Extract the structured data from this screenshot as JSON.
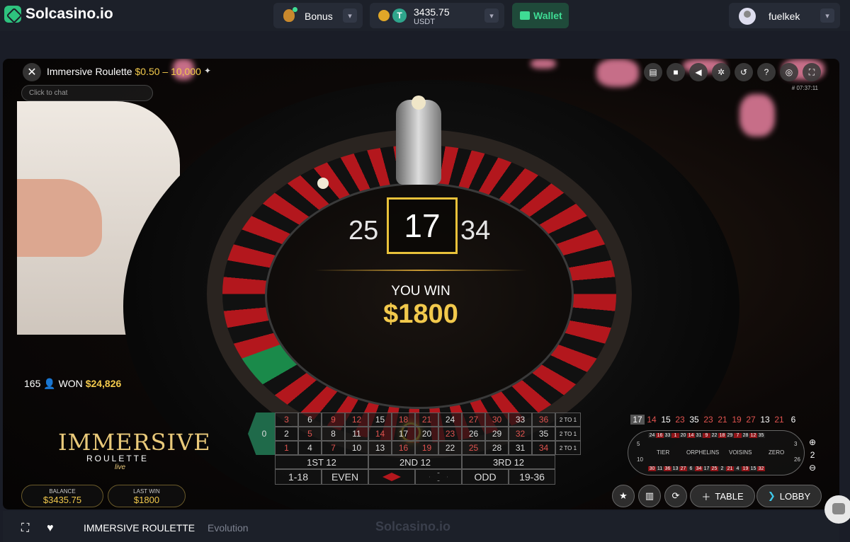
{
  "nav": {
    "brand": "Solcasino.io",
    "bonus_label": "Bonus",
    "balance": "3435.75",
    "currency": "USDT",
    "currency_symbol": "T",
    "wallet_label": "Wallet",
    "username": "fuelkek"
  },
  "game": {
    "title": "Immersive Roulette",
    "limits": "$0.50 – 10,000",
    "chat_placeholder": "Click to chat",
    "timestamp": "# 07:37:11",
    "result_prev": "25",
    "result": "17",
    "result_next": "34",
    "win_label": "YOU WIN",
    "win_amount": "$1800",
    "players": "165",
    "won_label": "WON",
    "won_amount": "$24,826",
    "brand_name": "IMMERSIVE",
    "brand_sub": "ROULETTE",
    "brand_live": "live",
    "balance_label": "BALANCE",
    "balance_value": "$3435.75",
    "lastwin_label": "LAST WIN",
    "lastwin_value": "$1800",
    "table_label": "TABLE",
    "lobby_label": "LOBBY"
  },
  "bet_grid": {
    "zero": "0",
    "rows": [
      [
        "3",
        "6",
        "9",
        "12",
        "15",
        "18",
        "21",
        "24",
        "27",
        "30",
        "33",
        "36"
      ],
      [
        "2",
        "5",
        "8",
        "11",
        "14",
        "17",
        "20",
        "23",
        "26",
        "29",
        "32",
        "35"
      ],
      [
        "1",
        "4",
        "7",
        "10",
        "13",
        "16",
        "19",
        "22",
        "25",
        "28",
        "31",
        "34"
      ]
    ],
    "red_numbers": [
      "1",
      "3",
      "5",
      "7",
      "9",
      "12",
      "14",
      "16",
      "18",
      "19",
      "21",
      "23",
      "25",
      "27",
      "30",
      "32",
      "34",
      "36"
    ],
    "column_label": "2 TO 1",
    "dozens": [
      "1ST 12",
      "2ND 12",
      "3RD 12"
    ],
    "outside": [
      "1-18",
      "EVEN",
      "",
      "",
      "ODD",
      "19-36"
    ]
  },
  "recent_results": [
    "17",
    "14",
    "15",
    "23",
    "35",
    "23",
    "21",
    "19",
    "27",
    "13",
    "21",
    "6"
  ],
  "racetrack": {
    "top": [
      "24",
      "16",
      "33",
      "1",
      "20",
      "14",
      "31",
      "9",
      "22",
      "18",
      "29",
      "7",
      "28",
      "12",
      "35"
    ],
    "bottom": [
      "30",
      "11",
      "36",
      "13",
      "27",
      "6",
      "34",
      "17",
      "25",
      "2",
      "21",
      "4",
      "19",
      "15",
      "32"
    ],
    "labels": [
      "TIER",
      "ORPHELINS",
      "VOISINS",
      "ZERO"
    ],
    "right": [
      "3",
      "26"
    ],
    "left": [
      "5",
      "10"
    ],
    "zoom_value": "2"
  },
  "footer": {
    "title": "IMMERSIVE ROULETTE",
    "provider": "Evolution",
    "watermark": "Solcasino.io"
  },
  "colors": {
    "accent_gold": "#f2c94c",
    "brand_green": "#3fdc94",
    "roulette_red": "#b3171d"
  }
}
